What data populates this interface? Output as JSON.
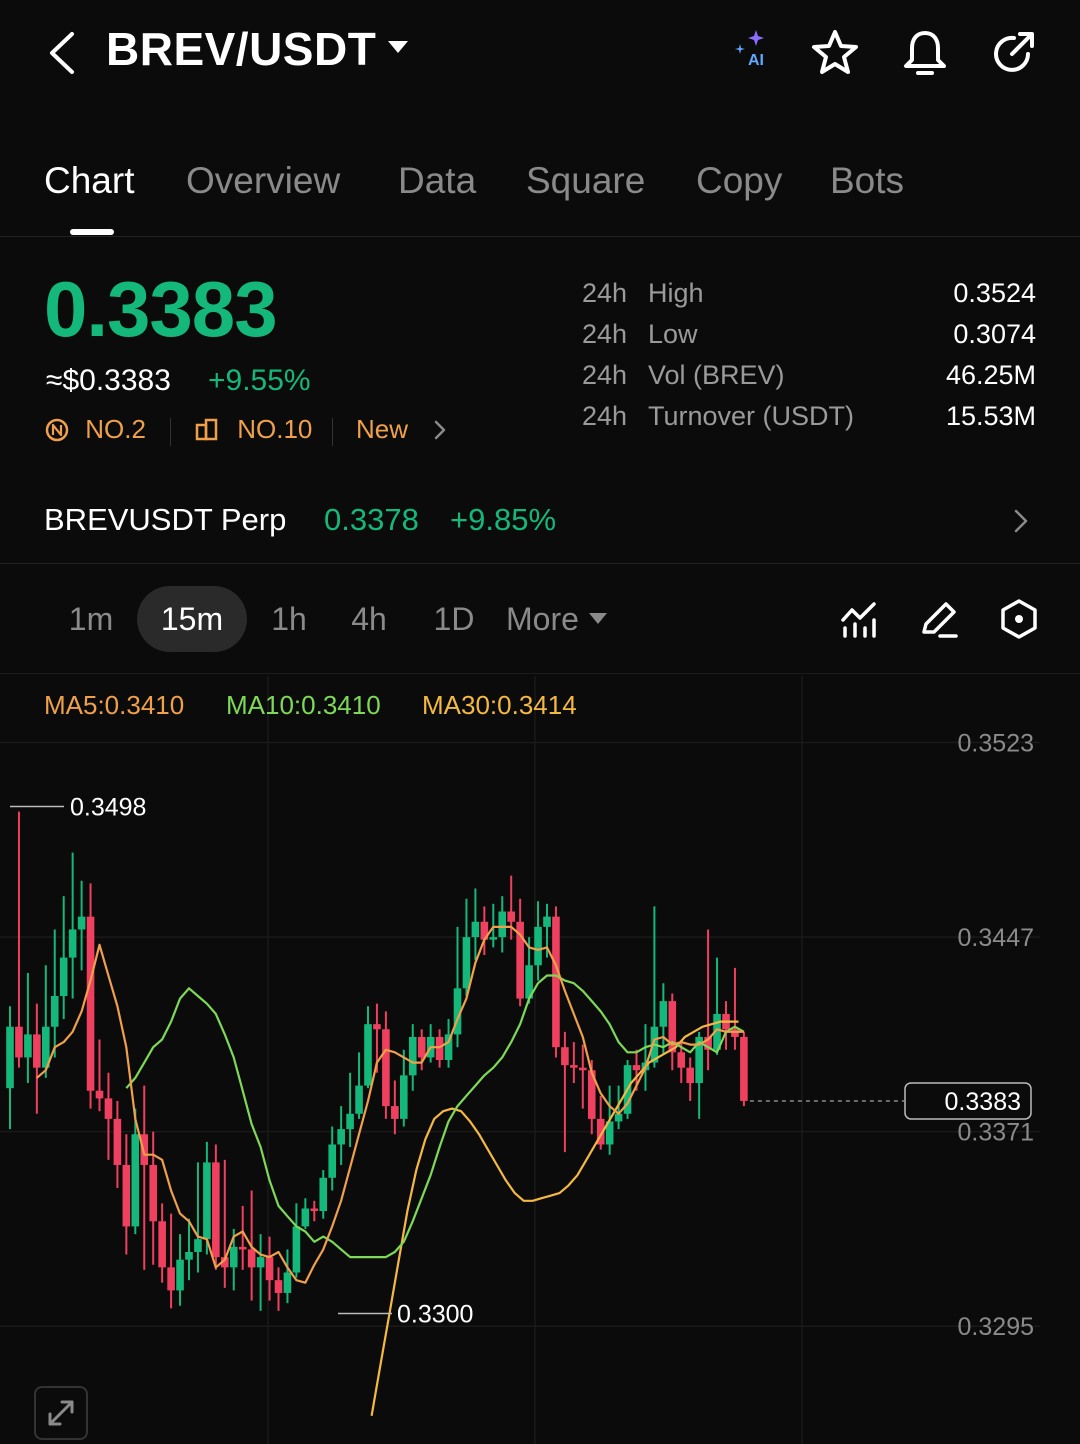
{
  "header": {
    "pair": "BREV/USDT",
    "ai_label": "AI",
    "icons": [
      "back-icon",
      "ai-icon",
      "star-icon",
      "bell-icon",
      "share-icon"
    ]
  },
  "tabs": [
    "Chart",
    "Overview",
    "Data",
    "Square",
    "Copy",
    "Bots"
  ],
  "active_tab": "Chart",
  "ticker": {
    "price": "0.3383",
    "usd_price": "≈$0.3383",
    "change": "+9.55%",
    "rank1": "NO.2",
    "rank2": "NO.10",
    "new_label": "New"
  },
  "stats": [
    {
      "period": "24h",
      "label": "High",
      "value": "0.3524"
    },
    {
      "period": "24h",
      "label": "Low",
      "value": "0.3074"
    },
    {
      "period": "24h",
      "label": "Vol (BREV)",
      "value": "46.25M"
    },
    {
      "period": "24h",
      "label": "Turnover (USDT)",
      "value": "15.53M"
    }
  ],
  "perp": {
    "name": "BREVUSDT Perp",
    "price": "0.3378",
    "change": "+9.85%"
  },
  "intervals": [
    "1m",
    "15m",
    "1h",
    "4h",
    "1D",
    "More"
  ],
  "selected_interval": "15m",
  "colors": {
    "up": "#14b87a",
    "down": "#f0405f",
    "ma5": "#f0a04b",
    "ma10": "#7ed957",
    "ma30": "#f5b942",
    "accent": "#f0a04b"
  },
  "chart_data": {
    "type": "candlestick",
    "ma_labels": {
      "ma5": "MA5:0.3410",
      "ma10": "MA10:0.3410",
      "ma30": "MA30:0.3414"
    },
    "y_ticks": [
      "0.3523",
      "0.3447",
      "0.3371",
      "0.3295"
    ],
    "current_price": "0.3383",
    "high_marker": "0.3498",
    "low_marker": "0.3300",
    "ylim": [
      0.3249,
      0.3549
    ],
    "candles": [
      [
        0.3388,
        0.3412,
        0.3372,
        0.342
      ],
      [
        0.3412,
        0.34,
        0.3396,
        0.3496
      ],
      [
        0.34,
        0.3409,
        0.339,
        0.3433
      ],
      [
        0.3409,
        0.3396,
        0.3378,
        0.3421
      ],
      [
        0.3396,
        0.3412,
        0.3392,
        0.3436
      ],
      [
        0.3412,
        0.3424,
        0.34,
        0.345
      ],
      [
        0.3424,
        0.3439,
        0.3415,
        0.3463
      ],
      [
        0.3439,
        0.345,
        0.3423,
        0.348
      ],
      [
        0.345,
        0.3455,
        0.3434,
        0.3469
      ],
      [
        0.3455,
        0.3387,
        0.338,
        0.3468
      ],
      [
        0.3387,
        0.3384,
        0.3379,
        0.3407
      ],
      [
        0.3384,
        0.3376,
        0.336,
        0.3394
      ],
      [
        0.3376,
        0.3358,
        0.3349,
        0.3383
      ],
      [
        0.3358,
        0.3334,
        0.3323,
        0.337
      ],
      [
        0.3334,
        0.337,
        0.3331,
        0.338
      ],
      [
        0.337,
        0.3358,
        0.3317,
        0.3389
      ],
      [
        0.3358,
        0.3336,
        0.3319,
        0.3371
      ],
      [
        0.3336,
        0.3318,
        0.3312,
        0.3343
      ],
      [
        0.3318,
        0.3309,
        0.3302,
        0.3339
      ],
      [
        0.3309,
        0.3321,
        0.3303,
        0.3331
      ],
      [
        0.3321,
        0.3324,
        0.3313,
        0.3337
      ],
      [
        0.3324,
        0.3329,
        0.3316,
        0.3359
      ],
      [
        0.3329,
        0.3359,
        0.3323,
        0.3367
      ],
      [
        0.3359,
        0.3322,
        0.3317,
        0.3366
      ],
      [
        0.3322,
        0.3318,
        0.331,
        0.336
      ],
      [
        0.3318,
        0.3326,
        0.3309,
        0.3333
      ],
      [
        0.3326,
        0.3325,
        0.3317,
        0.3342
      ],
      [
        0.3325,
        0.3318,
        0.3305,
        0.3348
      ],
      [
        0.3318,
        0.3322,
        0.3301,
        0.3331
      ],
      [
        0.3322,
        0.3313,
        0.3305,
        0.333
      ],
      [
        0.3313,
        0.3308,
        0.3301,
        0.3318
      ],
      [
        0.3308,
        0.3316,
        0.3304,
        0.3325
      ],
      [
        0.3316,
        0.3334,
        0.3314,
        0.3343
      ],
      [
        0.3334,
        0.3341,
        0.3333,
        0.3345
      ],
      [
        0.3341,
        0.334,
        0.3336,
        0.3344
      ],
      [
        0.334,
        0.3353,
        0.3337,
        0.3356
      ],
      [
        0.3353,
        0.3366,
        0.3348,
        0.3373
      ],
      [
        0.3366,
        0.3372,
        0.3358,
        0.3381
      ],
      [
        0.3372,
        0.3378,
        0.3365,
        0.3394
      ],
      [
        0.3378,
        0.3389,
        0.3376,
        0.3402
      ],
      [
        0.3389,
        0.3413,
        0.3388,
        0.342
      ],
      [
        0.3413,
        0.3411,
        0.3394,
        0.3421
      ],
      [
        0.3411,
        0.3381,
        0.3376,
        0.3418
      ],
      [
        0.3381,
        0.3376,
        0.337,
        0.3391
      ],
      [
        0.3376,
        0.3393,
        0.3373,
        0.3403
      ],
      [
        0.3393,
        0.3408,
        0.3387,
        0.3413
      ],
      [
        0.3408,
        0.34,
        0.3395,
        0.3411
      ],
      [
        0.34,
        0.3408,
        0.3398,
        0.3413
      ],
      [
        0.3408,
        0.3399,
        0.3396,
        0.3411
      ],
      [
        0.3399,
        0.3409,
        0.3396,
        0.3415
      ],
      [
        0.3409,
        0.3427,
        0.3404,
        0.3451
      ],
      [
        0.3427,
        0.3447,
        0.3424,
        0.3462
      ],
      [
        0.3447,
        0.3453,
        0.3438,
        0.3466
      ],
      [
        0.3453,
        0.3446,
        0.344,
        0.3459
      ],
      [
        0.3446,
        0.3447,
        0.3443,
        0.346
      ],
      [
        0.3447,
        0.3457,
        0.3441,
        0.3463
      ],
      [
        0.3457,
        0.3453,
        0.3446,
        0.3471
      ],
      [
        0.3453,
        0.3423,
        0.342,
        0.3462
      ],
      [
        0.3423,
        0.3436,
        0.3421,
        0.3447
      ],
      [
        0.3436,
        0.3451,
        0.343,
        0.3461
      ],
      [
        0.3451,
        0.3455,
        0.3439,
        0.346
      ],
      [
        0.3455,
        0.3404,
        0.34,
        0.3459
      ],
      [
        0.3404,
        0.3397,
        0.3363,
        0.341
      ],
      [
        0.3397,
        0.3396,
        0.339,
        0.3406
      ],
      [
        0.3396,
        0.3395,
        0.338,
        0.3405
      ],
      [
        0.3395,
        0.3376,
        0.337,
        0.3399
      ],
      [
        0.3376,
        0.3366,
        0.3364,
        0.3385
      ],
      [
        0.3366,
        0.3375,
        0.3362,
        0.3389
      ],
      [
        0.3375,
        0.3378,
        0.3372,
        0.3389
      ],
      [
        0.3378,
        0.3397,
        0.3376,
        0.3399
      ],
      [
        0.3397,
        0.3395,
        0.3387,
        0.3403
      ],
      [
        0.3395,
        0.3398,
        0.3387,
        0.3413
      ],
      [
        0.3398,
        0.3412,
        0.3396,
        0.3459
      ],
      [
        0.3412,
        0.3422,
        0.3401,
        0.3429
      ],
      [
        0.3422,
        0.3402,
        0.3395,
        0.3425
      ],
      [
        0.3402,
        0.3396,
        0.339,
        0.3406
      ],
      [
        0.3396,
        0.339,
        0.3383,
        0.34
      ],
      [
        0.339,
        0.3408,
        0.3376,
        0.341
      ],
      [
        0.3408,
        0.3403,
        0.3395,
        0.345
      ],
      [
        0.3403,
        0.3417,
        0.3401,
        0.3439
      ],
      [
        0.3417,
        0.3411,
        0.3403,
        0.3422
      ],
      [
        0.3411,
        0.3408,
        0.3403,
        0.3435
      ],
      [
        0.3408,
        0.3383,
        0.3381,
        0.341
      ]
    ],
    "ma5": [
      0.3392,
      0.3395,
      0.3404,
      0.3406,
      0.341,
      0.3418,
      0.343,
      0.3444,
      0.3432,
      0.342,
      0.3404,
      0.3376,
      0.3362,
      0.3362,
      0.336,
      0.3348,
      0.3339,
      0.3336,
      0.333,
      0.3329,
      0.3318,
      0.3321,
      0.333,
      0.3332,
      0.3326,
      0.3323,
      0.3322,
      0.3324,
      0.3318,
      0.3313,
      0.3312,
      0.3319,
      0.3325,
      0.3334,
      0.3344,
      0.3357,
      0.337,
      0.3383,
      0.3398,
      0.3403,
      0.3402,
      0.34,
      0.3398,
      0.3398,
      0.3404,
      0.3404,
      0.3406,
      0.3415,
      0.3423,
      0.3437,
      0.3446,
      0.3451,
      0.3451,
      0.3451,
      0.3448,
      0.3443,
      0.3442,
      0.3443,
      0.3436,
      0.3426,
      0.3417,
      0.3408,
      0.3394,
      0.3386,
      0.3381,
      0.3378,
      0.3382,
      0.3389,
      0.3396,
      0.3407,
      0.3408,
      0.3405,
      0.3406,
      0.3405,
      0.3405,
      0.3407,
      0.3411,
      0.341,
      0.341,
      0.341
    ],
    "ma10": [
      0.3388,
      0.3392,
      0.3398,
      0.3404,
      0.3407,
      0.3414,
      0.3423,
      0.3427,
      0.3424,
      0.3421,
      0.3417,
      0.3409,
      0.34,
      0.3387,
      0.3374,
      0.3365,
      0.3352,
      0.3342,
      0.3338,
      0.3334,
      0.3332,
      0.3328,
      0.333,
      0.3328,
      0.3325,
      0.3322,
      0.3322,
      0.3322,
      0.3322,
      0.3322,
      0.3324,
      0.3328,
      0.3336,
      0.3345,
      0.3354,
      0.3365,
      0.3375,
      0.3381,
      0.3385,
      0.3389,
      0.3393,
      0.3396,
      0.34,
      0.3406,
      0.3413,
      0.3423,
      0.3429,
      0.3432,
      0.3432,
      0.343,
      0.3429,
      0.3426,
      0.3422,
      0.3418,
      0.3413,
      0.3406,
      0.3402,
      0.3402,
      0.3404,
      0.3405,
      0.3404,
      0.3406,
      0.3404,
      0.3402,
      0.3406,
      0.3404,
      0.3402,
      0.341,
      0.3412,
      0.341
    ],
    "ma30": [
      0.326,
      0.328,
      0.33,
      0.332,
      0.334,
      0.3356,
      0.3368,
      0.3376,
      0.3379,
      0.338,
      0.3379,
      0.3375,
      0.337,
      0.3364,
      0.3358,
      0.3352,
      0.3347,
      0.3344,
      0.3344,
      0.3345,
      0.3346,
      0.3347,
      0.335,
      0.3354,
      0.336,
      0.3366,
      0.3372,
      0.3378,
      0.3384,
      0.339,
      0.3394,
      0.3398,
      0.34,
      0.3402,
      0.3404,
      0.3408,
      0.341,
      0.3412,
      0.3413,
      0.3414,
      0.3414,
      0.3414
    ]
  }
}
